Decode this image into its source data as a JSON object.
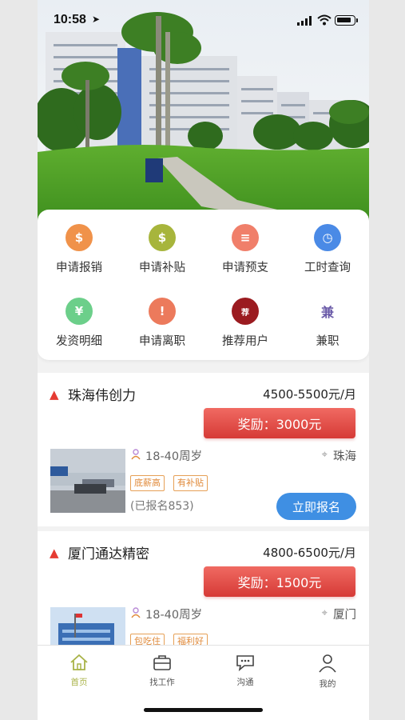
{
  "status_bar": {
    "time": "10:58"
  },
  "menu": [
    {
      "label": "申请报销",
      "icon": "money-bag-icon",
      "color": "#f0924a",
      "glyph": "$"
    },
    {
      "label": "申请补贴",
      "icon": "subsidy-bag-icon",
      "color": "#a7b53c",
      "glyph": "$"
    },
    {
      "label": "申请预支",
      "icon": "document-icon",
      "color": "#f07f6a",
      "glyph": "≡"
    },
    {
      "label": "工时查询",
      "icon": "clock-icon",
      "color": "#4a8ae6",
      "glyph": "◷"
    },
    {
      "label": "发资明细",
      "icon": "yen-coin-icon",
      "color": "#6ccf8a",
      "glyph": "¥"
    },
    {
      "label": "申请离职",
      "icon": "alert-icon",
      "color": "#ec7a5c",
      "glyph": "!"
    },
    {
      "label": "推荐用户",
      "icon": "recommend-badge-icon",
      "color": "#9b1b20",
      "glyph": "荐"
    },
    {
      "label": "兼职",
      "icon": "part-time-icon",
      "color": "#ffffff",
      "glyph": "兼"
    }
  ],
  "jobs": [
    {
      "company": "珠海伟创力",
      "salary": "4500-5500元/月",
      "reward": "奖励：3000元",
      "age": "18-40周岁",
      "location": "珠海",
      "tags": [
        "底薪高",
        "有补贴"
      ],
      "signed": "(已报名853)",
      "apply": "立即报名"
    },
    {
      "company": "厦门通达精密",
      "salary": "4800-6500元/月",
      "reward": "奖励：1500元",
      "age": "18-40周岁",
      "location": "厦门",
      "tags": [
        "包吃住",
        "福利好"
      ]
    }
  ],
  "tabs": [
    {
      "label": "首页",
      "icon": "home-icon"
    },
    {
      "label": "找工作",
      "icon": "briefcase-icon"
    },
    {
      "label": "沟通",
      "icon": "chat-icon"
    },
    {
      "label": "我的",
      "icon": "person-icon"
    }
  ],
  "colors": {
    "accent": "#a9b348",
    "reward": "#e04c46",
    "apply": "#3f8fe3",
    "tag": "#e08a3a"
  }
}
